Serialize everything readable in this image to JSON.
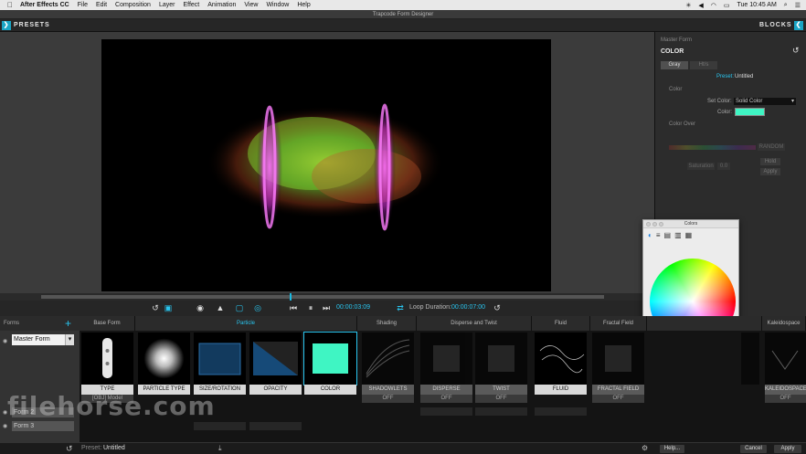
{
  "menubar": {
    "app": "After Effects CC",
    "items": [
      "File",
      "Edit",
      "Composition",
      "Layer",
      "Effect",
      "Animation",
      "View",
      "Window",
      "Help"
    ],
    "clock": "Tue 10:45 AM"
  },
  "window": {
    "title": "Trapcode Form Designer"
  },
  "topbar": {
    "presets": "PRESETS",
    "blocks": "BLOCKS"
  },
  "transport": {
    "timecode": "00:00:03:09",
    "loop_label": "Loop Duration:",
    "loop_value": "00:00:07:00"
  },
  "panel": {
    "title": "Master Form",
    "section": "COLOR",
    "tabs": [
      "Gray",
      "Ht/s"
    ],
    "preset_label": "Preset:",
    "preset_value": "Untitled",
    "color_label": "Color",
    "set_color_label": "Set Color:",
    "set_color_value": "Solid Color",
    "color_field_label": "Color:",
    "color_value": "#3ff5c3",
    "color_over_label": "Color Over",
    "swatch_count_value": "RANDOM",
    "btn_a": "Hold",
    "btn_b": "Apply",
    "slider_label": "Saturation",
    "slider_value": "0.0"
  },
  "colors_window": {
    "title": "Colors"
  },
  "forms": {
    "header": "Forms",
    "master": "Master Form",
    "items": [
      "Form 2",
      "Form 3"
    ]
  },
  "columns": [
    {
      "head": "Base Form"
    },
    {
      "head": "Particle"
    },
    {
      "head": "Shading"
    },
    {
      "head": "Disperse and Twist"
    },
    {
      "head": "Fluid"
    },
    {
      "head": "Fractal Field"
    },
    {
      "head": "Kaleidospace"
    }
  ],
  "tiles": [
    {
      "label": "TYPE",
      "sub": "[OBJ] Model"
    },
    {
      "label": "PARTICLE TYPE",
      "sub": ""
    },
    {
      "label": "SIZE/ROTATION",
      "sub": ""
    },
    {
      "label": "OPACITY",
      "sub": ""
    },
    {
      "label": "COLOR",
      "sub": ""
    },
    {
      "label": "SHADOWLETS",
      "sub": "OFF"
    },
    {
      "label": "DISPERSE",
      "sub": "OFF"
    },
    {
      "label": "TWIST",
      "sub": "OFF"
    },
    {
      "label": "FLUID",
      "sub": ""
    },
    {
      "label": "FRACTAL FIELD",
      "sub": "OFF"
    },
    {
      "label": "KALEIDOSPACE",
      "sub": "OFF"
    }
  ],
  "bottombar": {
    "preset_label": "Preset:",
    "preset_value": "Untitled",
    "help": "Help...",
    "cancel": "Cancel",
    "apply": "Apply"
  },
  "watermark": "filehorse.com"
}
